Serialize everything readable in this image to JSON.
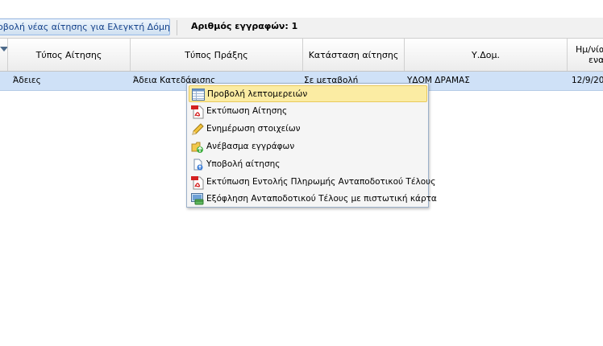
{
  "toolbar": {
    "new_request_button": "οβολή νέας αίτησης για Ελεγκτή Δόμησης",
    "record_count": "Αριθμός εγγραφών: 1"
  },
  "grid": {
    "columns": [
      "Τύπος Αίτησης",
      "Τύπος Πράξης",
      "Κατάσταση αίτησης",
      "Υ.Δομ.",
      "Ημ/νία",
      "ενα"
    ],
    "rows": [
      {
        "request_type": "Άδειες",
        "act_type": "Άδεια Κατεδάφισης",
        "status": "Σε μεταβολή",
        "building_service": "ΥΔΟΜ ΔΡΑΜΑΣ",
        "date": "12/9/20"
      }
    ]
  },
  "context_menu": {
    "items": [
      {
        "label": "Προβολή λεπτομερειών",
        "icon": "details-table-icon"
      },
      {
        "label": "Εκτύπωση Αίτησης",
        "icon": "pdf-icon"
      },
      {
        "label": "Ενημέρωση στοιχείων",
        "icon": "pencil-icon"
      },
      {
        "label": "Ανέβασμα εγγράφων",
        "icon": "upload-folder-icon"
      },
      {
        "label": "Υποβολή αίτησης",
        "icon": "submit-document-icon"
      },
      {
        "label": "Εκτύπωση Εντολής Πληρωμής Ανταποδοτικού Τέλους",
        "icon": "pdf-icon"
      },
      {
        "label": "Εξόφληση Ανταποδοτικού Τέλους με πιστωτική κάρτα",
        "icon": "credit-card-screen-icon"
      }
    ]
  },
  "colors": {
    "selected_row": "#cfe1f7",
    "menu_highlight": "#fbeca3",
    "button_border": "#99bbe8"
  }
}
